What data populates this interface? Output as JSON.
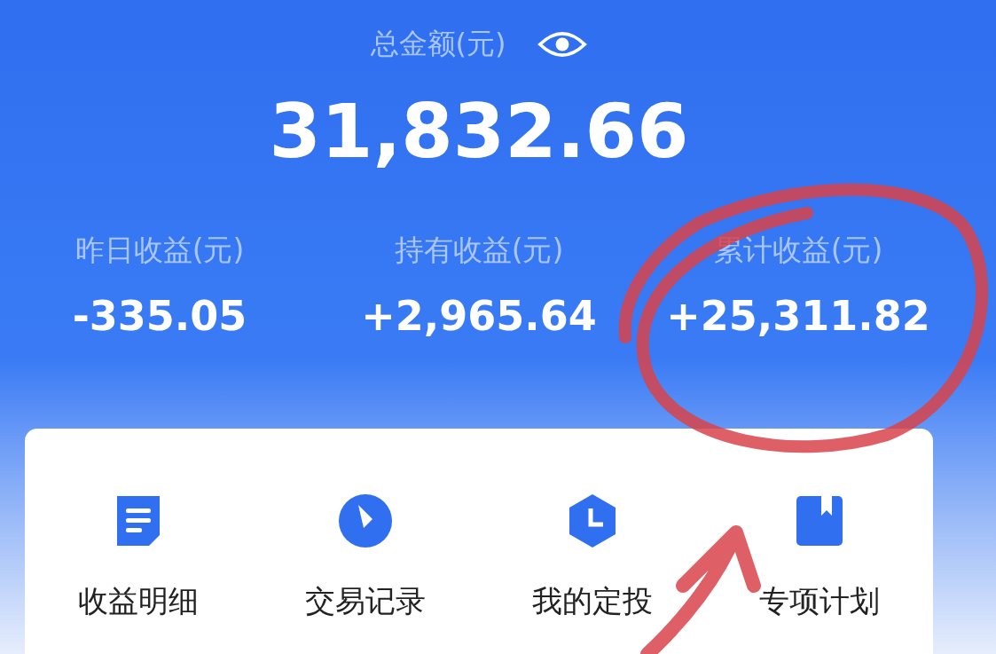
{
  "total": {
    "label": "总金额(元)",
    "amount": "31,832.66"
  },
  "stats": [
    {
      "label": "昨日收益(元)",
      "value": "-335.05"
    },
    {
      "label": "持有收益(元)",
      "value": "+2,965.64"
    },
    {
      "label": "累计收益(元)",
      "value": "+25,311.82"
    }
  ],
  "shortcuts": [
    {
      "kind": "document",
      "label": "收益明细"
    },
    {
      "kind": "compass",
      "label": "交易记录"
    },
    {
      "kind": "clock",
      "label": "我的定投"
    },
    {
      "kind": "bookmark",
      "label": "专项计划"
    }
  ]
}
